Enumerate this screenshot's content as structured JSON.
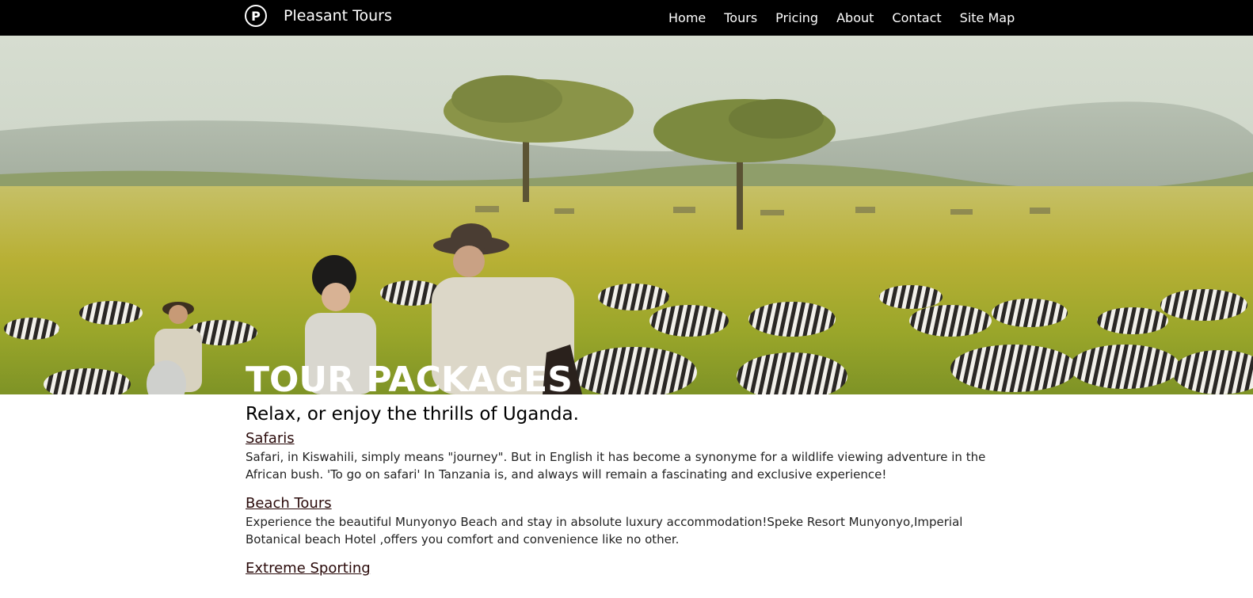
{
  "header": {
    "logo_letter": "P",
    "brand": "Pleasant Tours",
    "nav": [
      "Home",
      "Tours",
      "Pricing",
      "About",
      "Contact",
      "Site Map"
    ]
  },
  "hero": {
    "title": "TOUR PACKAGES",
    "image": "savanna-safari-zebras-horse-riders"
  },
  "content": {
    "tagline": "Relax, or enjoy the thrills of Uganda.",
    "sections": [
      {
        "title": "Safaris",
        "text": "Safari, in Kiswahili, simply means \"journey\". But in English it has become a synonyme for a wildlife viewing adventure in the African bush. 'To go on safari' In Tanzania is, and always will remain a fascinating and exclusive experience!"
      },
      {
        "title": "Beach Tours",
        "text": "Experience the beautiful Munyonyo Beach and stay in absolute luxury accommodation!Speke Resort Munyonyo,Imperial Botanical beach Hotel ,offers you comfort and convenience like no other."
      },
      {
        "title": "Extreme Sporting",
        "text": ""
      }
    ]
  },
  "colors": {
    "topbar": "#000000",
    "link": "#2a0a0a",
    "hero_text": "#ffffff"
  }
}
